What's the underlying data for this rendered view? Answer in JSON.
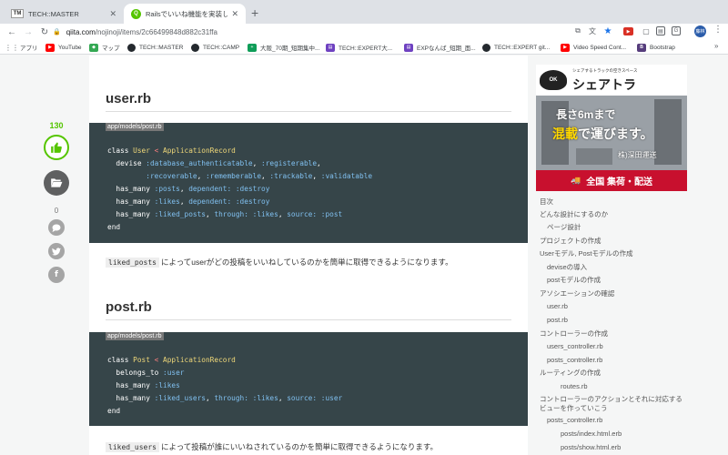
{
  "browser": {
    "tabs": [
      {
        "favicon": "TM",
        "title": "TECH::MASTER"
      },
      {
        "favicon": "Q",
        "title": "Railsでいいね機能を実装しよう -"
      }
    ],
    "url": {
      "host": "qiita.com",
      "path": "/nojinoji/items/2c66499848d882c31ffa"
    },
    "profile_initials": "藤林",
    "bookmarks": [
      {
        "icon": "apps-grid-icon",
        "label": "アプリ"
      },
      {
        "icon": "youtube-icon",
        "label": "YouTube"
      },
      {
        "icon": "maps-icon",
        "label": "マップ"
      },
      {
        "icon": "github-icon",
        "label": "TECH::MASTER"
      },
      {
        "icon": "github-icon",
        "label": "TECH::CAMP"
      },
      {
        "icon": "sheets-icon",
        "label": "大阪_70期_短期集中..."
      },
      {
        "icon": "expert-icon",
        "label": "TECH::EXPERT大..."
      },
      {
        "icon": "expert-icon",
        "label": "EXPなんば_短期_面..."
      },
      {
        "icon": "github-icon",
        "label": "TECH::EXPERT git..."
      },
      {
        "icon": "youtube-icon",
        "label": "Video Speed Cont..."
      },
      {
        "icon": "bootstrap-icon",
        "label": "Bootstrap"
      }
    ]
  },
  "rail": {
    "like_count": "130",
    "comment_count": "0"
  },
  "article": {
    "sections": [
      {
        "heading": "user.rb",
        "file_label": "app/models/post.rb",
        "lines": [
          [
            {
              "t": "class ",
              "c": "kw"
            },
            {
              "t": "User",
              "c": "cls"
            },
            {
              "t": " < ",
              "c": "op"
            },
            {
              "t": "ApplicationRecord",
              "c": "cls"
            }
          ],
          [
            {
              "t": "  devise ",
              "c": "kw"
            },
            {
              "t": ":database_authenticatable",
              "c": "sym"
            },
            {
              "t": ", ",
              "c": "kw"
            },
            {
              "t": ":registerable",
              "c": "sym"
            },
            {
              "t": ",",
              "c": "kw"
            }
          ],
          [
            {
              "t": "         ",
              "c": "kw"
            },
            {
              "t": ":recoverable",
              "c": "sym"
            },
            {
              "t": ", ",
              "c": "kw"
            },
            {
              "t": ":rememberable",
              "c": "sym"
            },
            {
              "t": ", ",
              "c": "kw"
            },
            {
              "t": ":trackable",
              "c": "sym"
            },
            {
              "t": ", ",
              "c": "kw"
            },
            {
              "t": ":validatable",
              "c": "sym"
            }
          ],
          [
            {
              "t": "  has_many ",
              "c": "kw"
            },
            {
              "t": ":posts",
              "c": "sym"
            },
            {
              "t": ", ",
              "c": "kw"
            },
            {
              "t": "dependent:",
              "c": "sym"
            },
            {
              "t": " ",
              "c": "kw"
            },
            {
              "t": ":destroy",
              "c": "sym"
            }
          ],
          [
            {
              "t": "  has_many ",
              "c": "kw"
            },
            {
              "t": ":likes",
              "c": "sym"
            },
            {
              "t": ", ",
              "c": "kw"
            },
            {
              "t": "dependent:",
              "c": "sym"
            },
            {
              "t": " ",
              "c": "kw"
            },
            {
              "t": ":destroy",
              "c": "sym"
            }
          ],
          [
            {
              "t": "  has_many ",
              "c": "kw"
            },
            {
              "t": ":liked_posts",
              "c": "sym"
            },
            {
              "t": ", ",
              "c": "kw"
            },
            {
              "t": "through:",
              "c": "sym"
            },
            {
              "t": " ",
              "c": "kw"
            },
            {
              "t": ":likes",
              "c": "sym"
            },
            {
              "t": ", ",
              "c": "kw"
            },
            {
              "t": "source:",
              "c": "sym"
            },
            {
              "t": " ",
              "c": "kw"
            },
            {
              "t": ":post",
              "c": "sym"
            }
          ],
          [
            {
              "t": "end",
              "c": "kw"
            }
          ]
        ],
        "para_code": "liked_posts",
        "para_text": "によってuserがどの投稿をいいねしているのかを簡単に取得できるようになります。"
      },
      {
        "heading": "post.rb",
        "file_label": "app/models/post.rb",
        "lines": [
          [
            {
              "t": "class ",
              "c": "kw"
            },
            {
              "t": "Post",
              "c": "cls"
            },
            {
              "t": " < ",
              "c": "op"
            },
            {
              "t": "ApplicationRecord",
              "c": "cls"
            }
          ],
          [
            {
              "t": "  belongs_to ",
              "c": "kw"
            },
            {
              "t": ":user",
              "c": "sym"
            }
          ],
          [
            {
              "t": "  has_many ",
              "c": "kw"
            },
            {
              "t": ":likes",
              "c": "sym"
            }
          ],
          [
            {
              "t": "  has_many ",
              "c": "kw"
            },
            {
              "t": ":liked_users",
              "c": "sym"
            },
            {
              "t": ", ",
              "c": "kw"
            },
            {
              "t": "through:",
              "c": "sym"
            },
            {
              "t": " ",
              "c": "kw"
            },
            {
              "t": ":likes",
              "c": "sym"
            },
            {
              "t": ", ",
              "c": "kw"
            },
            {
              "t": "source:",
              "c": "sym"
            },
            {
              "t": " ",
              "c": "kw"
            },
            {
              "t": ":user",
              "c": "sym"
            }
          ],
          [
            {
              "t": "end",
              "c": "kw"
            }
          ]
        ],
        "para_code": "liked_users",
        "para_text": "によって投稿が誰にいいねされているのかを簡単に取得できるようになります。"
      }
    ]
  },
  "ad": {
    "tagline": "シェアするトラックの空きスペース",
    "brand": "シェアトラ",
    "logo": "OK",
    "line1": "長さ6mまで",
    "line2_highlight": "混載",
    "line2_rest": "で運びます。",
    "company": "株)深田運送",
    "bottom": "全国 集荷・配送"
  },
  "toc": [
    {
      "label": "目次",
      "level": 1
    },
    {
      "label": "どんな設計にするのか",
      "level": 1
    },
    {
      "label": "ページ設計",
      "level": 2
    },
    {
      "label": "プロジェクトの作成",
      "level": 1
    },
    {
      "label": "Userモデル, Postモデルの作成",
      "level": 1
    },
    {
      "label": "deviseの導入",
      "level": 2
    },
    {
      "label": "postモデルの作成",
      "level": 2
    },
    {
      "label": "アソシエーションの確認",
      "level": 1
    },
    {
      "label": "user.rb",
      "level": 2
    },
    {
      "label": "post.rb",
      "level": 2
    },
    {
      "label": "コントローラーの作成",
      "level": 1
    },
    {
      "label": "users_controller.rb",
      "level": 2
    },
    {
      "label": "posts_controller.rb",
      "level": 2
    },
    {
      "label": "ルーティングの作成",
      "level": 1
    },
    {
      "label": "routes.rb",
      "level": 3
    },
    {
      "label": "コントローラーのアクションとそれに対応するビューを作っていこう",
      "level": 1
    },
    {
      "label": "posts_controller.rb",
      "level": 2
    },
    {
      "label": "posts/index.html.erb",
      "level": 3
    },
    {
      "label": "posts/show.html.erb",
      "level": 3
    }
  ],
  "colors": {
    "qiita_green": "#55c500",
    "code_bg": "#364549",
    "ad_red": "#c8102e"
  }
}
